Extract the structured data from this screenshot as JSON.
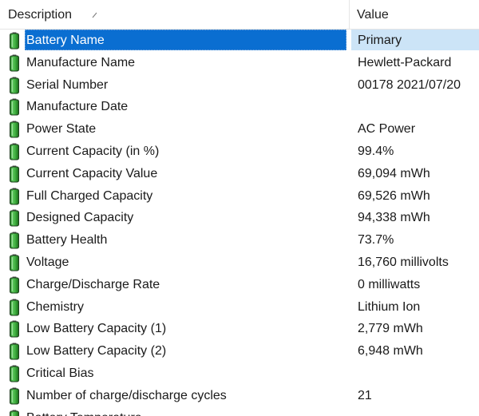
{
  "header": {
    "description": "Description",
    "value": "Value"
  },
  "rows": [
    {
      "label": "Battery Name",
      "value": "Primary"
    },
    {
      "label": "Manufacture Name",
      "value": "Hewlett-Packard"
    },
    {
      "label": "Serial Number",
      "value": "00178 2021/07/20"
    },
    {
      "label": "Manufacture Date",
      "value": ""
    },
    {
      "label": "Power State",
      "value": "AC Power"
    },
    {
      "label": "Current Capacity (in %)",
      "value": "99.4%"
    },
    {
      "label": "Current Capacity Value",
      "value": "69,094 mWh"
    },
    {
      "label": "Full Charged Capacity",
      "value": "69,526 mWh"
    },
    {
      "label": "Designed Capacity",
      "value": "94,338 mWh"
    },
    {
      "label": "Battery Health",
      "value": "73.7%"
    },
    {
      "label": "Voltage",
      "value": "16,760 millivolts"
    },
    {
      "label": "Charge/Discharge Rate",
      "value": "0 milliwatts"
    },
    {
      "label": "Chemistry",
      "value": "Lithium Ion"
    },
    {
      "label": "Low Battery Capacity (1)",
      "value": "2,779 mWh"
    },
    {
      "label": "Low Battery Capacity (2)",
      "value": "6,948 mWh"
    },
    {
      "label": "Critical Bias",
      "value": ""
    },
    {
      "label": "Number of charge/discharge cycles",
      "value": "21"
    },
    {
      "label": "Battery Temperature",
      "value": ""
    }
  ],
  "selected_row": 0,
  "colors": {
    "selection": "#0a6ed1",
    "selection_value": "#cce4f7",
    "battery_icon": "#2e9b2e"
  },
  "icons": {
    "row_icon": "battery-icon",
    "sort_icon": "sort-indicator-icon"
  }
}
